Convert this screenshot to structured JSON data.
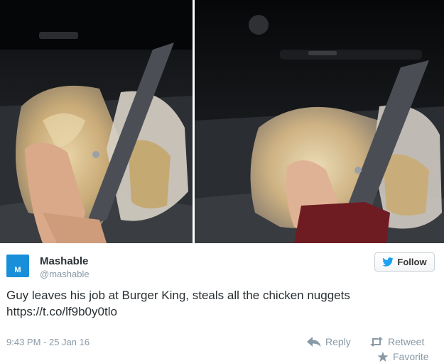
{
  "tweet": {
    "user": {
      "name": "Mashable",
      "handle": "@mashable",
      "avatar_letter": "M",
      "avatar_color": "#1a8fd9"
    },
    "follow_label": "Follow",
    "text_line1": "Guy leaves his job at Burger King, steals all the chicken nuggets",
    "text_line2": "https://t.co/lf9b0y0tlo",
    "timestamp": "9:43 PM - 25 Jan 16",
    "actions": {
      "reply": "Reply",
      "retweet": "Retweet",
      "favorite": "Favorite"
    },
    "colors": {
      "text": "#292f33",
      "muted": "#8899a6",
      "twitter_blue": "#1da1f2"
    }
  },
  "media": {
    "left_icon": "car-seat-nuggets-photo",
    "right_icon": "car-seat-nuggets-photo"
  }
}
